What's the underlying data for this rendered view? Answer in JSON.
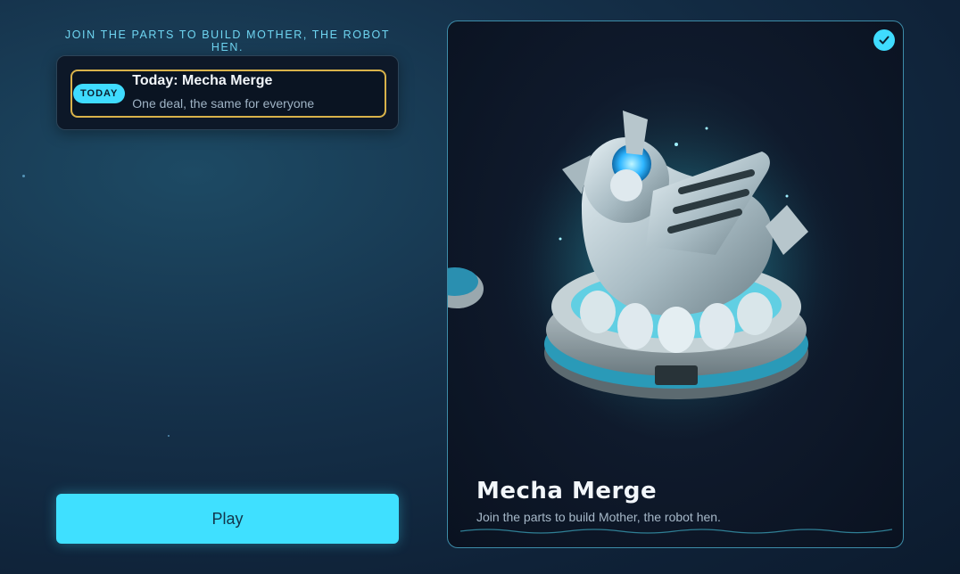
{
  "tagline": "JOIN THE PARTS TO BUILD MOTHER, THE ROBOT HEN.",
  "deal": {
    "badge": "TODAY",
    "title": "Today: Mecha Merge",
    "subtitle": "One deal, the same for everyone"
  },
  "play_button": {
    "label": "Play"
  },
  "game_card": {
    "title": "Mecha Merge",
    "subtitle": "Join the parts to build Mother, the robot hen.",
    "selected": true,
    "check_icon": "check-icon",
    "art_description": "robot-hen-on-nest-icon"
  },
  "colors": {
    "accent": "#3fdcff",
    "highlight_border": "#d8b24a",
    "panel_bg": "#0d1828",
    "background": "#15314a"
  }
}
